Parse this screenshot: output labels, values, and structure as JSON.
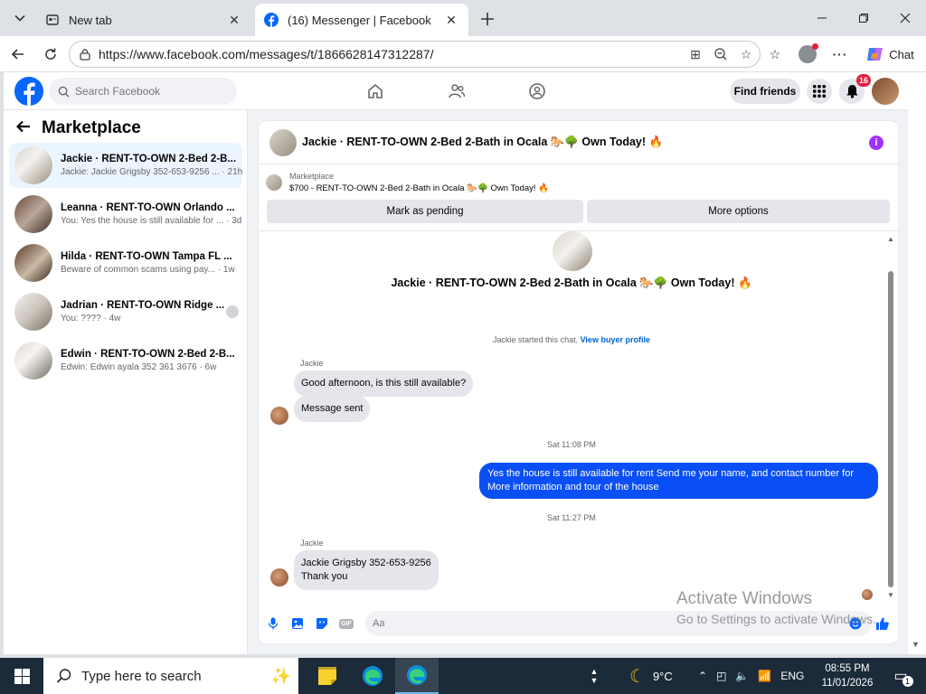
{
  "browser": {
    "tabs": [
      {
        "label": "New tab",
        "active": false
      },
      {
        "label": "(16) Messenger | Facebook",
        "active": true
      }
    ],
    "url": "https://www.facebook.com/messages/t/1866628147312287/",
    "chat_label": "Chat"
  },
  "fb": {
    "search_placeholder": "Search Facebook",
    "find_friends": "Find friends",
    "notification_count": "16",
    "brand_color": "#0866ff"
  },
  "sidebar": {
    "title": "Marketplace",
    "conversations": [
      {
        "name": "Jackie · RENT-TO-OWN 2-Bed 2-B...",
        "preview": "Jackie: Jackie Grigsby 352-653-9256 ... · 21h"
      },
      {
        "name": "Leanna · RENT-TO-OWN Orlando ...",
        "preview": "You: Yes the house is still available for ... · 3d"
      },
      {
        "name": "Hilda · RENT-TO-OWN Tampa FL ...",
        "preview": "Beware of common scams using pay... · 1w"
      },
      {
        "name": "Jadrian · RENT-TO-OWN Ridge ...",
        "preview": "You: ???? · 4w"
      },
      {
        "name": "Edwin · RENT-TO-OWN 2-Bed 2-B...",
        "preview": "Edwin: Edwin ayala 352 361 3676 · 6w"
      }
    ]
  },
  "chat": {
    "header_title": "Jackie · RENT-TO-OWN 2-Bed 2-Bath in Ocala 🐎🌳 Own Today! 🔥",
    "marketplace_label": "Marketplace",
    "listing": "$700 - RENT-TO-OWN 2-Bed 2-Bath in Ocala 🐎🌳 Own Today! 🔥",
    "mark_pending": "Mark as pending",
    "more_options": "More options",
    "big_title": "Jackie · RENT-TO-OWN 2-Bed 2-Bath in Ocala 🐎🌳 Own Today! 🔥",
    "started_text": "Jackie started this chat.",
    "view_profile": "View buyer profile",
    "sender1": "Jackie",
    "msg1": "Good afternoon, is this still available?",
    "msg2": "Message sent",
    "ts1": "Sat 11:08 PM",
    "out_msg": "Yes the house is still available for rent Send me your name, and contact number for More information and tour of the house",
    "ts2": "Sat 11:27 PM",
    "sender2": "Jackie",
    "msg3_line1": "Jackie Grigsby 352-653-9256",
    "msg3_line2": "Thank you",
    "composer_placeholder": "Aa"
  },
  "watermark": {
    "line1": "Activate Windows",
    "line2": "Go to Settings to activate Windows."
  },
  "taskbar": {
    "search_placeholder": "Type here to search",
    "weather": "9°C",
    "language": "ENG",
    "time": "08:55 PM",
    "date": "11/01/2026",
    "notif_count": "1"
  }
}
